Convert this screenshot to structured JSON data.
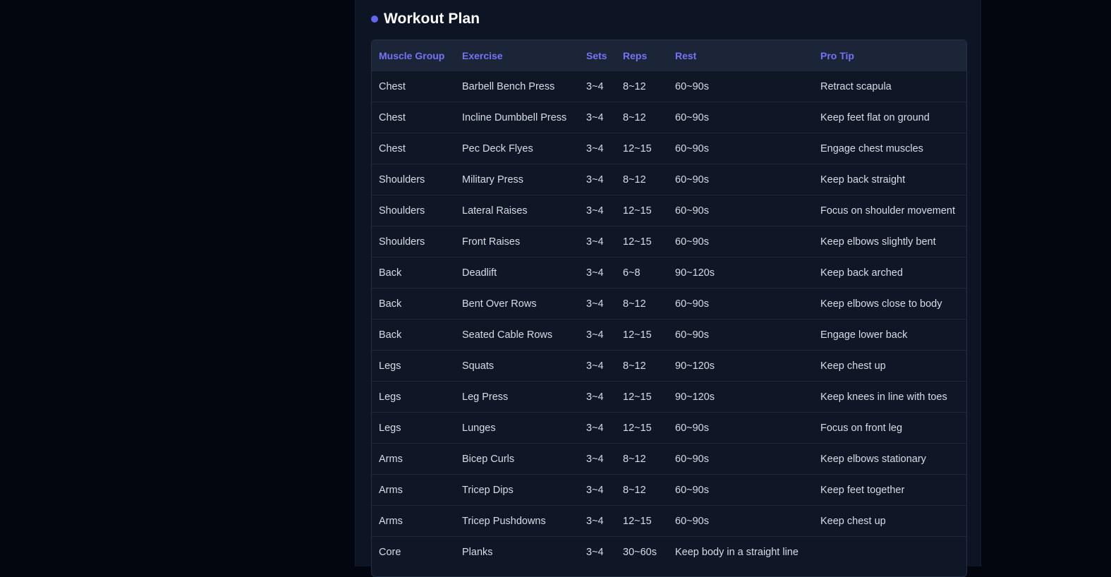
{
  "section": {
    "title": "Workout Plan"
  },
  "table": {
    "headers": [
      "Muscle Group",
      "Exercise",
      "Sets",
      "Reps",
      "Rest",
      "Pro Tip"
    ],
    "rows": [
      [
        "Chest",
        "Barbell Bench Press",
        "3~4",
        "8~12",
        "60~90s",
        "Retract scapula"
      ],
      [
        "Chest",
        "Incline Dumbbell Press",
        "3~4",
        "8~12",
        "60~90s",
        "Keep feet flat on ground"
      ],
      [
        "Chest",
        "Pec Deck Flyes",
        "3~4",
        "12~15",
        "60~90s",
        "Engage chest muscles"
      ],
      [
        "Shoulders",
        "Military Press",
        "3~4",
        "8~12",
        "60~90s",
        "Keep back straight"
      ],
      [
        "Shoulders",
        "Lateral Raises",
        "3~4",
        "12~15",
        "60~90s",
        "Focus on shoulder movement"
      ],
      [
        "Shoulders",
        "Front Raises",
        "3~4",
        "12~15",
        "60~90s",
        "Keep elbows slightly bent"
      ],
      [
        "Back",
        "Deadlift",
        "3~4",
        "6~8",
        "90~120s",
        "Keep back arched"
      ],
      [
        "Back",
        "Bent Over Rows",
        "3~4",
        "8~12",
        "60~90s",
        "Keep elbows close to body"
      ],
      [
        "Back",
        "Seated Cable Rows",
        "3~4",
        "12~15",
        "60~90s",
        "Engage lower back"
      ],
      [
        "Legs",
        "Squats",
        "3~4",
        "8~12",
        "90~120s",
        "Keep chest up"
      ],
      [
        "Legs",
        "Leg Press",
        "3~4",
        "12~15",
        "90~120s",
        "Keep knees in line with toes"
      ],
      [
        "Legs",
        "Lunges",
        "3~4",
        "12~15",
        "60~90s",
        "Focus on front leg"
      ],
      [
        "Arms",
        "Bicep Curls",
        "3~4",
        "8~12",
        "60~90s",
        "Keep elbows stationary"
      ],
      [
        "Arms",
        "Tricep Dips",
        "3~4",
        "8~12",
        "60~90s",
        "Keep feet together"
      ],
      [
        "Arms",
        "Tricep Pushdowns",
        "3~4",
        "12~15",
        "60~90s",
        "Keep chest up"
      ],
      [
        "Core",
        "Planks",
        "3~4",
        "30~60s",
        "Keep body in a straight line",
        ""
      ]
    ]
  },
  "colors": {
    "accent": "#6366f1",
    "header_text": "#7474f5",
    "page_bg": "#03060e",
    "panel_bg": "#0d1524"
  }
}
